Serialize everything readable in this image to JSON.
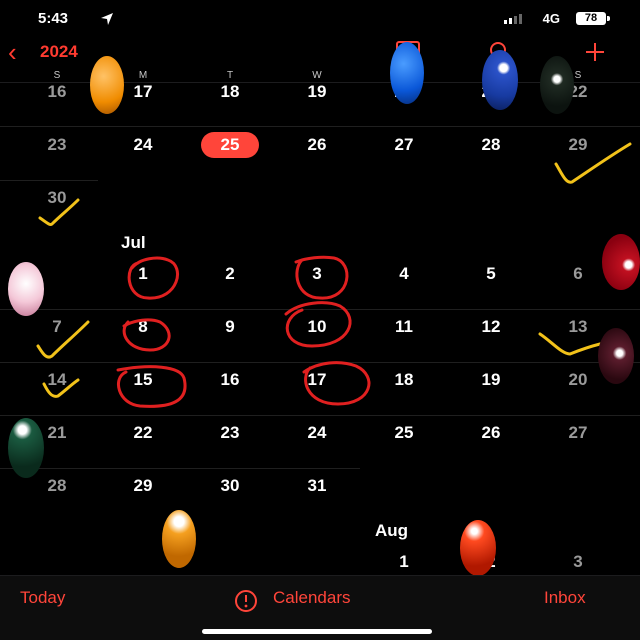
{
  "status_bar": {
    "time": "5:43",
    "network": "4G",
    "battery": "78"
  },
  "nav": {
    "year": "2024"
  },
  "weekdays": [
    "S",
    "M",
    "T",
    "W",
    "T",
    "F",
    "S"
  ],
  "months": {
    "july": "Jul",
    "august": "Aug"
  },
  "june_rows": [
    [
      "16",
      "17",
      "18",
      "19",
      "20",
      "21",
      "22"
    ],
    [
      "23",
      "24",
      "25",
      "26",
      "27",
      "28",
      "29"
    ],
    [
      "30"
    ]
  ],
  "july_rows": [
    [
      "1",
      "2",
      "3",
      "4",
      "5",
      "6"
    ],
    [
      "7",
      "8",
      "9",
      "10",
      "11",
      "12",
      "13"
    ],
    [
      "14",
      "15",
      "16",
      "17",
      "18",
      "19",
      "20"
    ],
    [
      "21",
      "22",
      "23",
      "24",
      "25",
      "26",
      "27"
    ],
    [
      "28",
      "29",
      "30",
      "31"
    ]
  ],
  "august_rows": [
    [
      "1",
      "2",
      "3"
    ]
  ],
  "today": "25",
  "tabs": {
    "today": "Today",
    "calendars": "Calendars",
    "inbox": "Inbox"
  },
  "colors": {
    "accent": "#ff453a",
    "highlight_circle": "#ff453a",
    "ink_red": "#e02020",
    "ink_yellow": "#f2c21a"
  }
}
